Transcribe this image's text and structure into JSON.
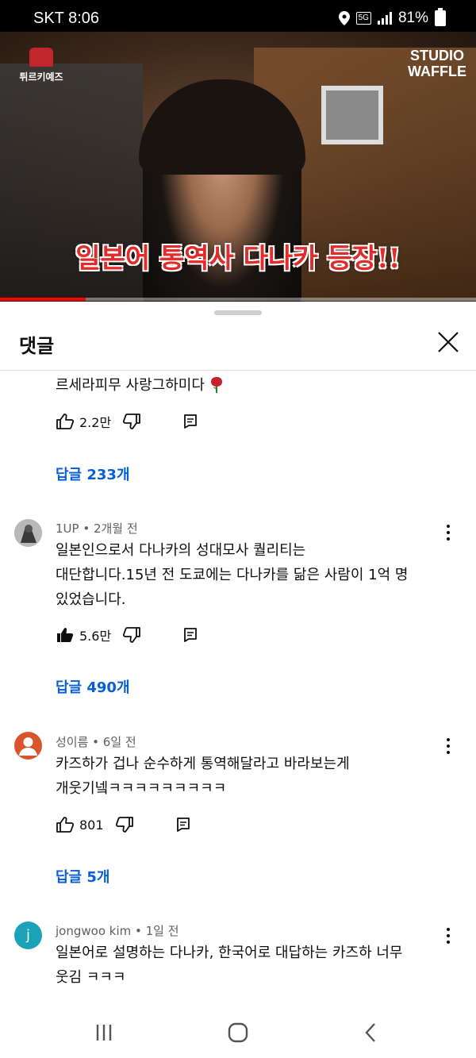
{
  "status_bar": {
    "carrier_time": "SKT 8:06",
    "network": "5G",
    "battery": "81%"
  },
  "video": {
    "channel_logo_text": "튀르키예즈",
    "studio_logo_line1": "STUDIO",
    "studio_logo_line2": "WAFFLE",
    "caption": "일본어 통역사 다나카 등장!!",
    "progress": 0.18
  },
  "comments_panel": {
    "title": "댓글",
    "comments": [
      {
        "text": "르세라피무 사랑그하미다",
        "likes": "2.2만",
        "replies": "답글 233개"
      },
      {
        "author_meta": "1UP • 2개월 전",
        "line1": "일본인으로서  다나카의 성대모사 퀄리티는",
        "line2": "대단합니다.15년 전 도쿄에는 다나카를 닮은 사람이 1억 명",
        "line3": "있었습니다.",
        "likes": "5.6만",
        "replies": "답글 490개"
      },
      {
        "author_meta": "성이름 • 6일 전",
        "line1": "카즈하가 겁나 순수하게 통역해달라고 바라보는게",
        "line2": "개웃기넼ㅋㅋㅋㅋㅋㅋㅋㅋㅋ",
        "likes": "801",
        "replies": "답글 5개"
      },
      {
        "author_meta": "jongwoo kim • 1일 전",
        "avatar_letter": "j",
        "line1": "일본어로 설명하는 다나카, 한국어로 대답하는 카즈하 너무",
        "line2": "웃김 ㅋㅋㅋ"
      }
    ]
  },
  "colors": {
    "link_blue": "#065fd4",
    "progress_red": "#ff0000",
    "avatar_teal": "#1aa2b8",
    "avatar_orange": "#d9542b",
    "caption_red": "#e32b2b"
  }
}
